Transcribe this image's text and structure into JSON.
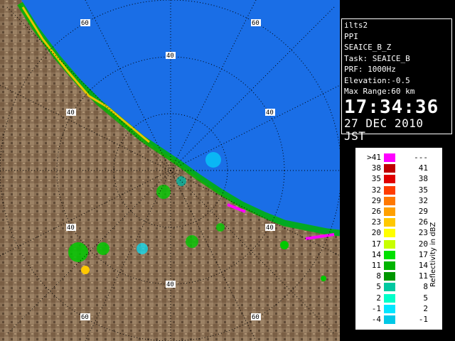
{
  "radar": {
    "range_rings_km": [
      20,
      40,
      60
    ],
    "ring_labels": [
      "60",
      "60",
      "40",
      "40",
      "40",
      "40",
      "40",
      "40",
      "60",
      "60"
    ],
    "colors": {
      "sea": "#1a6ee6",
      "land": "#8a7055",
      "grid": "#000000",
      "coast": "#ffffff",
      "rivers": "#7a6fb0",
      "roads": "#b0503a"
    }
  },
  "info": {
    "site": "ilts2",
    "product": "PPI",
    "product_code": "SEAICE_B_Z",
    "task": "Task: SEAICE_B",
    "prf": "PRF: 1000Hz",
    "elevation": "Elevation:-0.5",
    "max_range": "Max Range:60 km",
    "time": "17:34:36",
    "date": "27 DEC 2010 JST"
  },
  "scale": {
    "unit": "Reflectivity in dBZ",
    "rows": [
      {
        "min": ">41",
        "max": "---",
        "color": "#ff00ff"
      },
      {
        "min": "38",
        "max": "41",
        "color": "#c00000"
      },
      {
        "min": "35",
        "max": "38",
        "color": "#e00000"
      },
      {
        "min": "32",
        "max": "35",
        "color": "#ff3c00"
      },
      {
        "min": "29",
        "max": "32",
        "color": "#ff7800"
      },
      {
        "min": "26",
        "max": "29",
        "color": "#ffa000"
      },
      {
        "min": "23",
        "max": "26",
        "color": "#ffc800"
      },
      {
        "min": "20",
        "max": "23",
        "color": "#ffff00"
      },
      {
        "min": "17",
        "max": "20",
        "color": "#c8ff00"
      },
      {
        "min": "14",
        "max": "17",
        "color": "#00e000"
      },
      {
        "min": "11",
        "max": "14",
        "color": "#00b400"
      },
      {
        "min": "8",
        "max": "11",
        "color": "#009600"
      },
      {
        "min": "5",
        "max": "8",
        "color": "#00c8a0"
      },
      {
        "min": "2",
        "max": "5",
        "color": "#00ffc8"
      },
      {
        "min": "-1",
        "max": "2",
        "color": "#00e6ff"
      },
      {
        "min": "-4",
        "max": "-1",
        "color": "#00c8e6"
      }
    ]
  }
}
